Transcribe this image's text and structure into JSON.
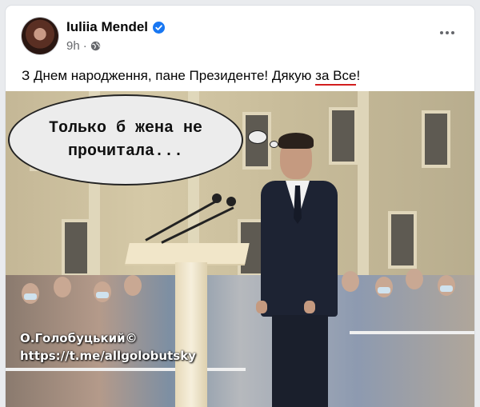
{
  "post": {
    "author": "Iuliia Mendel",
    "time": "9h",
    "separator": "·",
    "caption_before": "З Днем народження, пане Президенте! Дякую ",
    "caption_underlined": "за Все",
    "caption_after": "!"
  },
  "image": {
    "speech_line1": "Только б жена не",
    "speech_line2": "прочитала...",
    "watermark_line1": "О.Голобуцький©",
    "watermark_line2": "https://t.me/allgolobutsky"
  },
  "icons": {
    "verified": "verified-badge-icon",
    "audience": "globe-icon",
    "more": "more-options-icon"
  },
  "colors": {
    "verified_blue": "#1877f2",
    "underline_red": "#d21e1e"
  }
}
